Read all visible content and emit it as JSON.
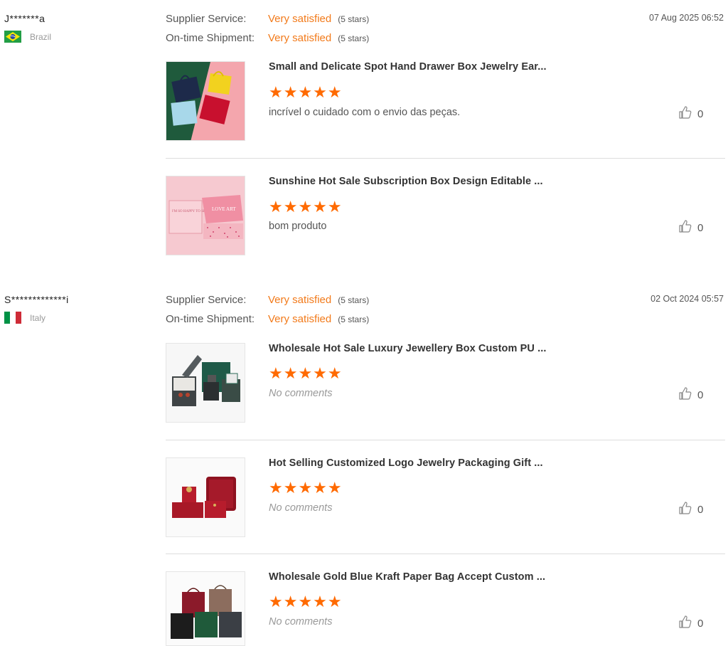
{
  "reviews": [
    {
      "reviewer": "J*******a",
      "country": "Brazil",
      "flag_icon": "brazil-flag-icon",
      "date": "07 Aug 2025 06:52",
      "supplier_service_label": "Supplier Service:",
      "supplier_service_value": "Very satisfied",
      "supplier_service_stars": "(5 stars)",
      "shipment_label": "On-time Shipment:",
      "shipment_value": "Very satisfied",
      "shipment_stars": "(5 stars)",
      "products": [
        {
          "title": "Small and Delicate Spot Hand Drawer Box Jewelry Ear...",
          "rating": 5,
          "stars": "★★★★★",
          "comment": "incrível o cuidado com o envio das peças.",
          "likes": "0"
        },
        {
          "title": "Sunshine Hot Sale Subscription Box Design Editable ...",
          "rating": 5,
          "stars": "★★★★★",
          "comment": "bom produto",
          "likes": "0"
        }
      ]
    },
    {
      "reviewer": "S*************i",
      "country": "Italy",
      "flag_icon": "italy-flag-icon",
      "date": "02 Oct 2024 05:57",
      "supplier_service_label": "Supplier Service:",
      "supplier_service_value": "Very satisfied",
      "supplier_service_stars": "(5 stars)",
      "shipment_label": "On-time Shipment:",
      "shipment_value": "Very satisfied",
      "shipment_stars": "(5 stars)",
      "products": [
        {
          "title": "Wholesale Hot Sale Luxury Jewellery Box Custom PU ...",
          "rating": 5,
          "stars": "★★★★★",
          "comment": "No comments",
          "likes": "0"
        },
        {
          "title": "Hot Selling Customized Logo Jewelry Packaging Gift ...",
          "rating": 5,
          "stars": "★★★★★",
          "comment": "No comments",
          "likes": "0"
        },
        {
          "title": "Wholesale Gold Blue Kraft Paper Bag Accept Custom ...",
          "rating": 5,
          "stars": "★★★★★",
          "comment": "No comments",
          "likes": "0"
        }
      ]
    }
  ],
  "thumb_texts": {
    "box_card": "I'M SO HAPPY TO SEE YOU",
    "box_lid": "LOVE ART"
  },
  "colors": {
    "accent_orange": "#f27a1a",
    "star_orange": "#ff6a00",
    "muted_gray": "#999999"
  },
  "like_icon": "thumbs-up-icon"
}
